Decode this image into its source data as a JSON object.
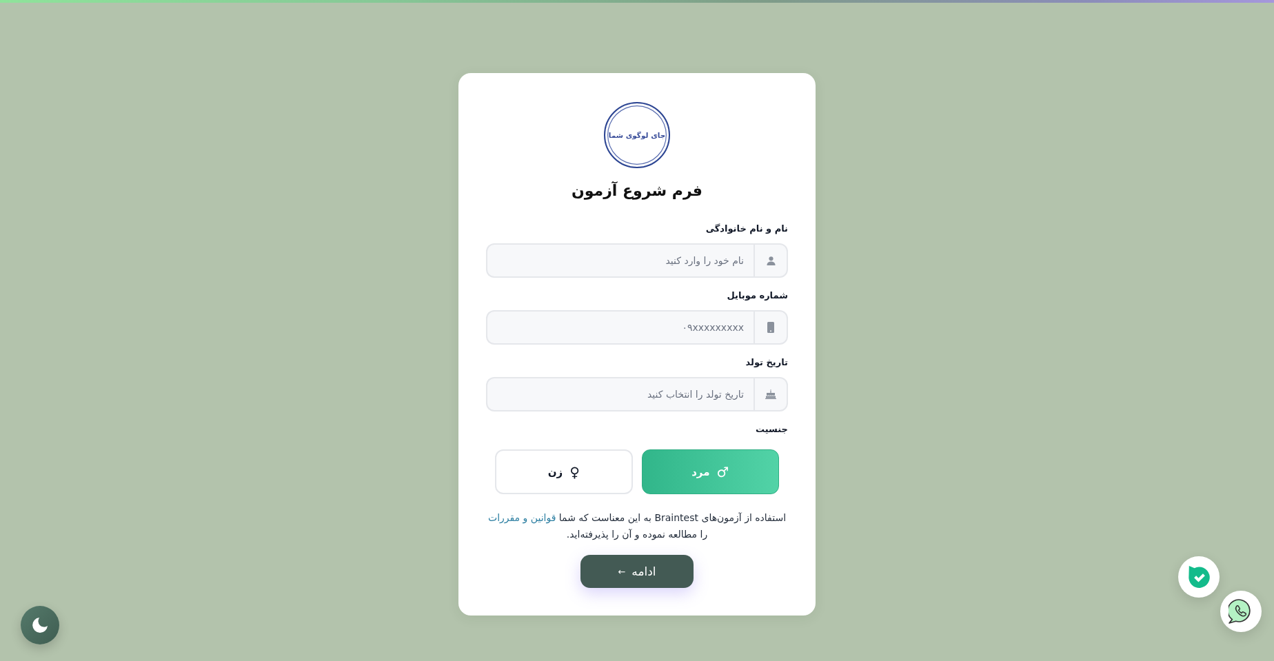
{
  "logo": {
    "text": "جای لوگوی شما"
  },
  "title": "فرم شروع آزمون",
  "fields": [
    {
      "label": "نام و نام خانوادگی",
      "placeholder": "نام خود را وارد کنید"
    },
    {
      "label": "شماره موبایل",
      "placeholder": "۰۹xxxxxxxxx"
    },
    {
      "label": "تاریخ تولد",
      "placeholder": "تاریخ تولد را انتخاب کنید"
    }
  ],
  "gender": {
    "label": "جنسیت",
    "options": [
      {
        "label": "مرد",
        "symbol": "♂",
        "selected": true
      },
      {
        "label": "زن",
        "symbol": "♀",
        "selected": false
      }
    ]
  },
  "terms": {
    "text_before": "استفاده از آزمون‌های Braintest به این معناست که شما",
    "link": "قوانین و مقررات",
    "text_after": "را مطالعه نموده و آن را پذیرفته‌اید."
  },
  "continue_button": {
    "label": "ادامه",
    "arrow": "←"
  }
}
